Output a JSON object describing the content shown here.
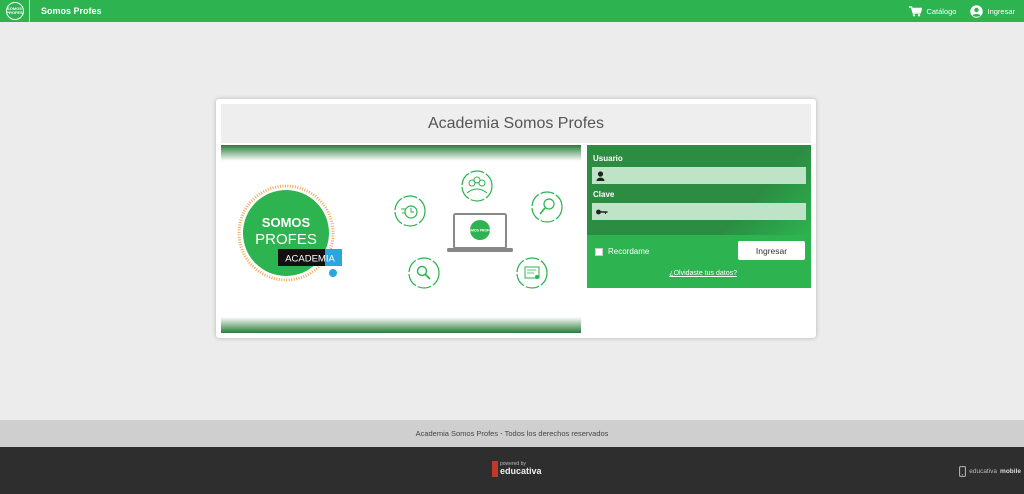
{
  "topbar": {
    "app_title": "Somos Profes",
    "catalog_label": "Catálogo",
    "login_label": "Ingresar",
    "logo_text": "SOMOS PROFES"
  },
  "card": {
    "title": "Academia Somos Profes"
  },
  "banner": {
    "logo_line1": "SOMOS",
    "logo_line2": "PROFES",
    "logo_tag": "ACADEMIA",
    "laptop_text": "SOMOS PROFES"
  },
  "login": {
    "user_label": "Usuario",
    "user_value": "",
    "password_label": "Clave",
    "password_value": "",
    "remember_label": "Recordame",
    "submit_label": "Ingresar",
    "forgot_link": "¿Olvidaste tus datos?"
  },
  "footer": {
    "copyright": "Academia Somos Profes - Todos los derechos reservados",
    "powered_small": "powered by",
    "powered_brand": "educativa",
    "mobile_prefix": "educativa",
    "mobile_suffix": "mobile"
  },
  "colors": {
    "brand_green": "#2db34f",
    "dark_green": "#2c8c42",
    "footer_dark": "#2e2e2e"
  }
}
